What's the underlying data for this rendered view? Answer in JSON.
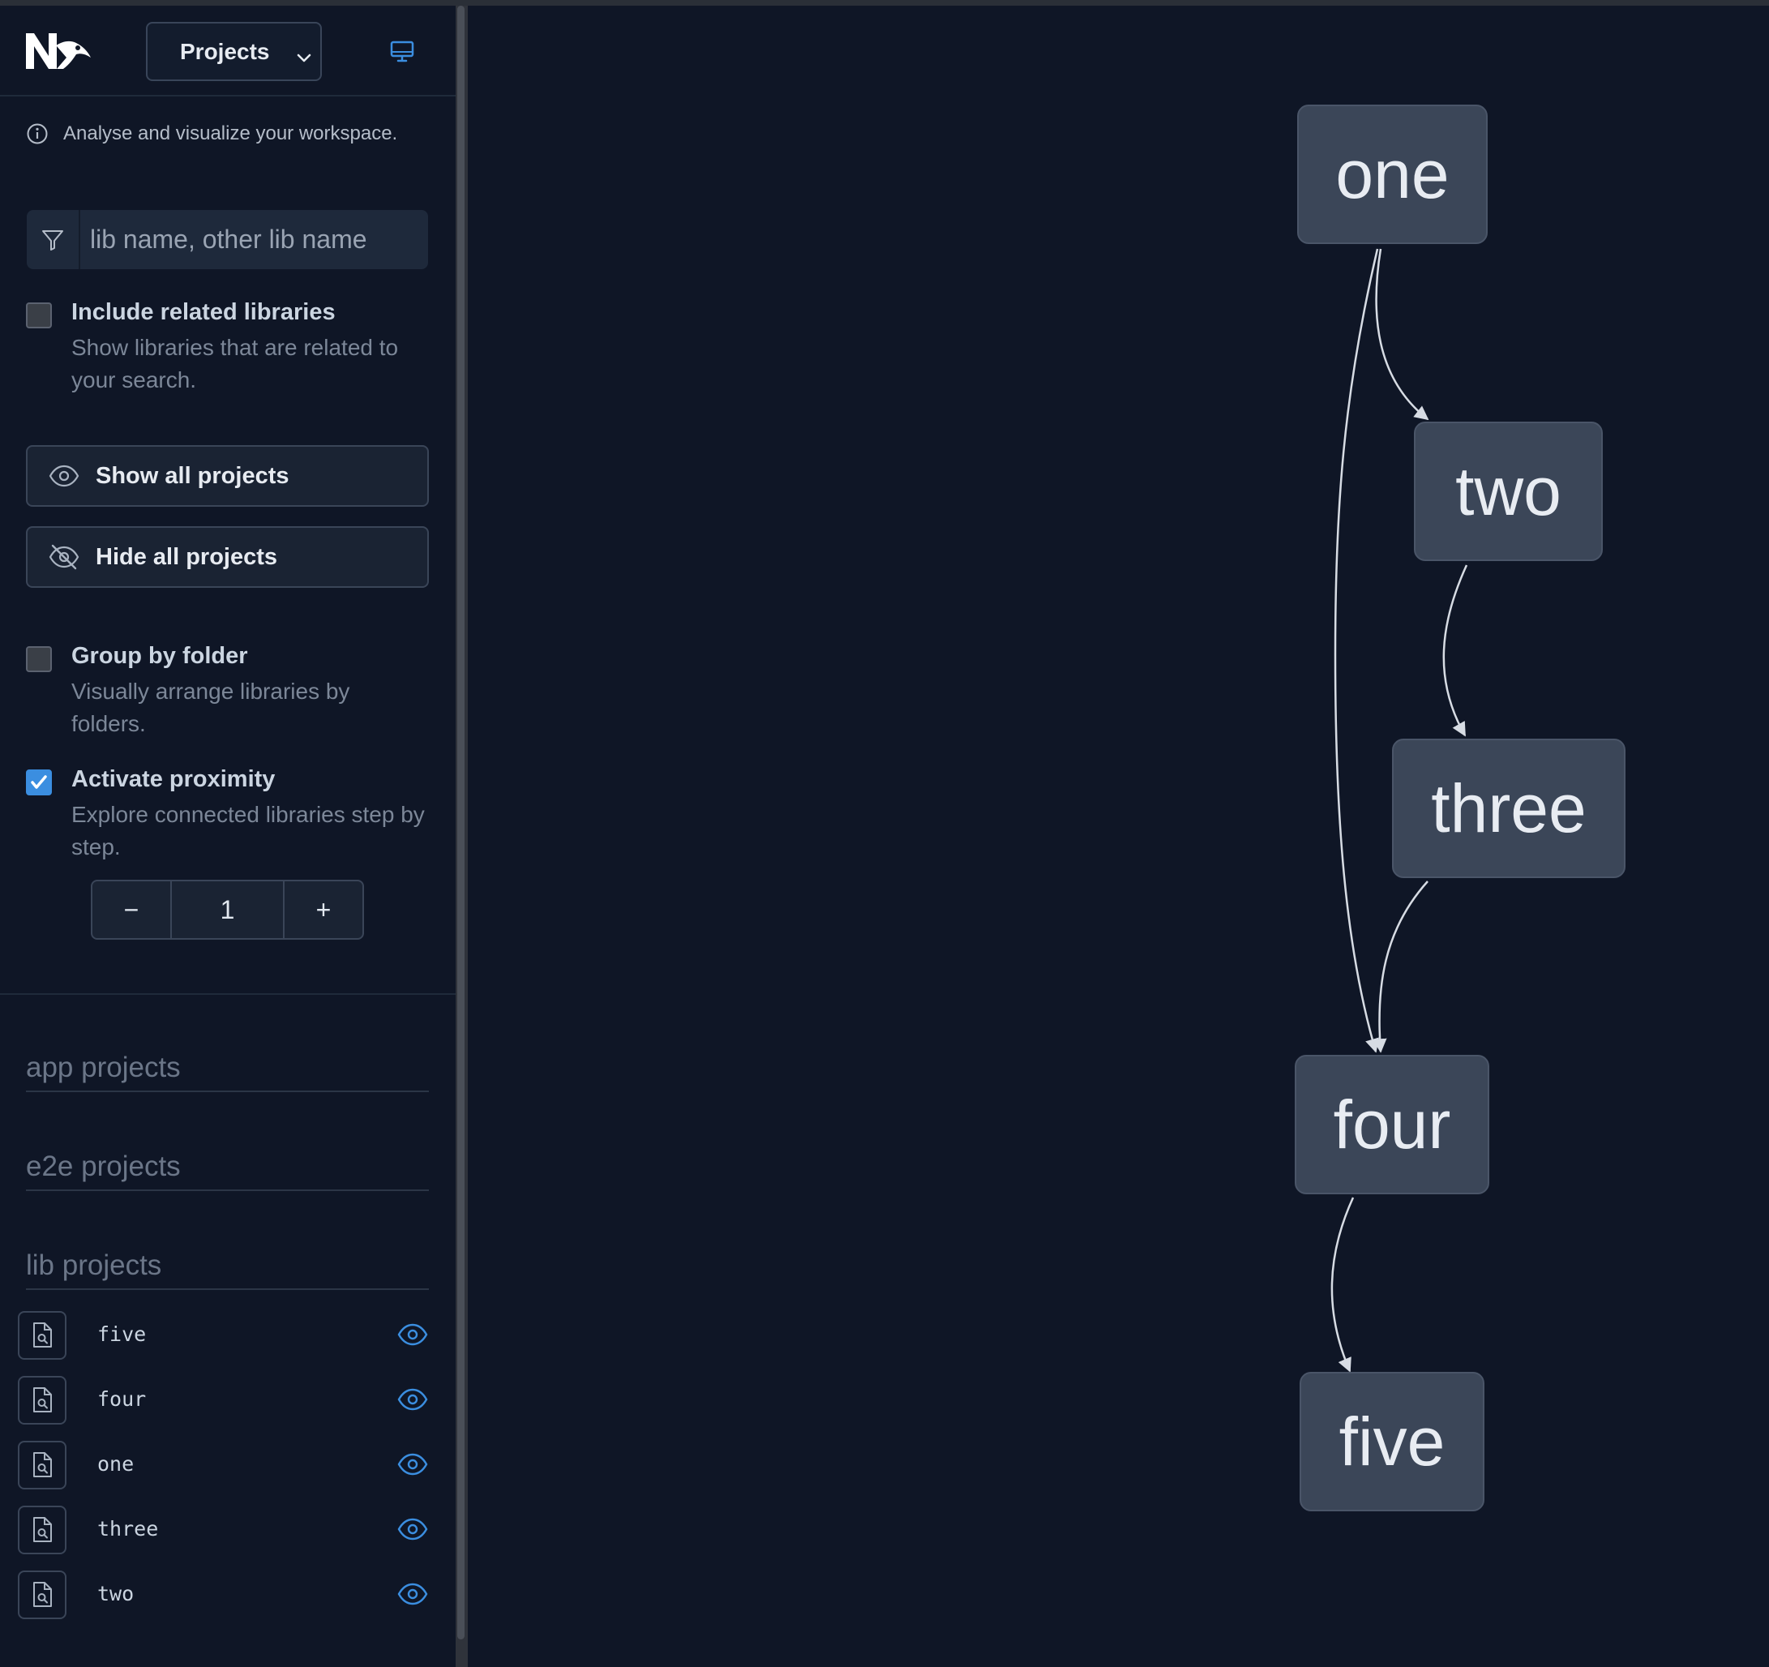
{
  "header": {
    "view_select": "Projects"
  },
  "info": {
    "text": "Analyse and visualize your workspace."
  },
  "search": {
    "placeholder": "lib name, other lib name"
  },
  "include_related": {
    "title": "Include related libraries",
    "description": "Show libraries that are related to your search.",
    "checked": false
  },
  "buttons": {
    "show_all": "Show all projects",
    "hide_all": "Hide all projects"
  },
  "group_by_folder": {
    "title": "Group by folder",
    "description": "Visually arrange libraries by folders.",
    "checked": false
  },
  "proximity": {
    "title": "Activate proximity",
    "description": "Explore connected libraries step by step.",
    "checked": true,
    "value": "1",
    "minus": "−",
    "plus": "+"
  },
  "project_groups": {
    "app": "app projects",
    "e2e": "e2e projects",
    "lib": "lib projects"
  },
  "lib_projects": [
    "five",
    "four",
    "one",
    "three",
    "two"
  ],
  "graph": {
    "nodes": [
      "one",
      "two",
      "three",
      "four",
      "five"
    ],
    "edges": [
      [
        "one",
        "two"
      ],
      [
        "one",
        "four"
      ],
      [
        "two",
        "three"
      ],
      [
        "three",
        "four"
      ],
      [
        "four",
        "five"
      ]
    ]
  },
  "colors": {
    "background": "#0f1626",
    "node_fill": "#3b4658",
    "accent": "#3b8ee0"
  }
}
